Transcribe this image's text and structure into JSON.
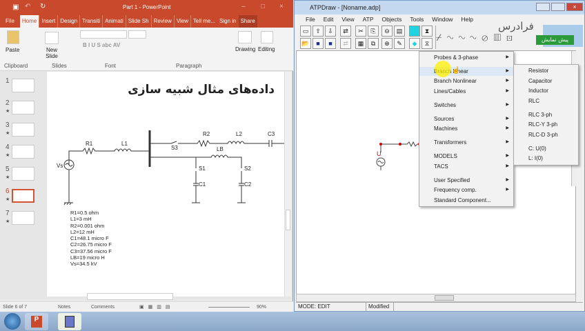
{
  "ppt": {
    "title": "Part 1 - PowerPoint",
    "tabs": [
      "File",
      "Home",
      "Insert",
      "Design",
      "Transiti",
      "Animati",
      "Slide Sh",
      "Review",
      "View",
      "Tell me...",
      "Sign in",
      "Share"
    ],
    "ribbon": {
      "paste": "Paste",
      "new_slide": "New Slide",
      "drawing": "Drawing",
      "editing": "Editing",
      "groups": [
        "Clipboard",
        "Slides",
        "Font",
        "Paragraph"
      ]
    },
    "thumbnails": [
      "1",
      "2",
      "3",
      "4",
      "5",
      "6",
      "7"
    ],
    "selected_slide": 6,
    "slide": {
      "title": "داده‌های مثال شبیه سازی",
      "labels": {
        "r1": "R1",
        "l1": "L1",
        "vs": "Vs",
        "s3": "S3",
        "r2": "R2",
        "l2": "L2",
        "c3": "C3",
        "lb": "LB",
        "s1": "S1",
        "s2": "S2",
        "c1": "C1",
        "c2": "C2"
      },
      "params": [
        "R1=0.5 ohm",
        "L1=3 mH",
        "R2=0.001 ohm",
        "L2=12 mH",
        "C1=48.1 micro F",
        "C2=26.75 micro F",
        "C3=37.56 micro F",
        "LB=19 micro H",
        "Vs=34.5 kV"
      ]
    },
    "status": {
      "slide_of": "Slide 6 of 7",
      "notes": "Notes",
      "comments": "Comments",
      "zoom": "90%"
    }
  },
  "atp": {
    "title": "ATPDraw - [Noname.adp]",
    "menu": [
      "File",
      "Edit",
      "View",
      "ATP",
      "Objects",
      "Tools",
      "Window",
      "Help"
    ],
    "canvas_label": "U",
    "context_menu": [
      {
        "label": "Probes & 3-phase",
        "sub": true
      },
      {
        "label": "Branch Linear",
        "sub": true,
        "highlight": true
      },
      {
        "label": "Branch Nonlinear",
        "sub": true
      },
      {
        "label": "Lines/Cables",
        "sub": true
      },
      {
        "label": "Switches",
        "sub": true
      },
      {
        "label": "Sources",
        "sub": true
      },
      {
        "label": "Machines",
        "sub": true
      },
      {
        "label": "Transformers",
        "sub": true
      },
      {
        "label": "MODELS",
        "sub": true
      },
      {
        "label": "TACS",
        "sub": true
      },
      {
        "label": "User Specified",
        "sub": true
      },
      {
        "label": "Frequency comp.",
        "sub": true
      },
      {
        "label": "Standard Component...",
        "sub": false
      }
    ],
    "submenu": [
      "Resistor",
      "Capacitor",
      "Inductor",
      "RLC",
      "RLC 3-ph",
      "RLC-Y 3-ph",
      "RLC-D 3-ph",
      "C: U(0)",
      "L: I(0)"
    ],
    "status": {
      "mode": "MODE: EDIT",
      "modified": "Modified"
    }
  },
  "watermark": {
    "text": "فرادرس",
    "badge": "پیش نمایش"
  }
}
